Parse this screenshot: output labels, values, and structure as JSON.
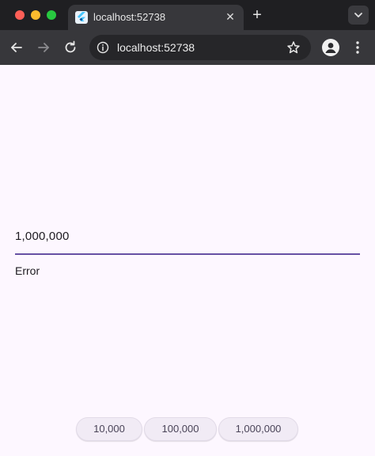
{
  "browser": {
    "tab": {
      "title": "localhost:52738",
      "favicon": "flutter-icon"
    },
    "address_bar": {
      "url": "localhost:52738"
    },
    "icons": {
      "back": "back-arrow-icon",
      "forward": "forward-arrow-icon",
      "reload": "reload-icon",
      "site_info": "info-icon",
      "bookmark": "star-icon",
      "profile": "profile-icon",
      "menu": "kebab-menu-icon",
      "tab_search": "chevron-down-icon",
      "new_tab": "plus-icon",
      "close_tab": "close-icon"
    },
    "new_tab_glyph": "+",
    "close_glyph": "✕"
  },
  "app": {
    "text_field": {
      "value": "1,000,000"
    },
    "error_text": "Error",
    "buttons": [
      {
        "label": "10,000"
      },
      {
        "label": "100,000"
      },
      {
        "label": "1,000,000"
      }
    ]
  },
  "colors": {
    "page_background": "#fdf7ff",
    "accent": "#6750a4",
    "chrome_dark": "#1f1f22",
    "toolbar": "#37373b"
  }
}
